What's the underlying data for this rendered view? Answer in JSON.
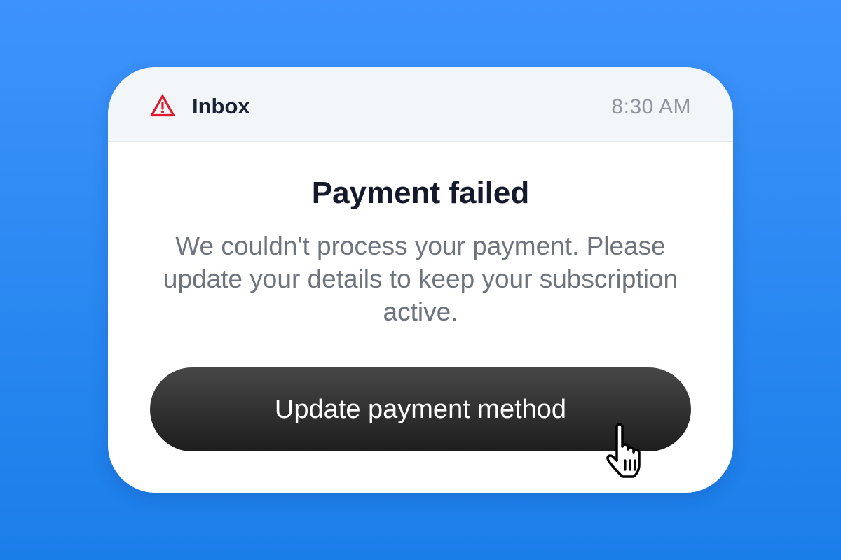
{
  "header": {
    "icon": "alert-triangle-icon",
    "title": "Inbox",
    "time": "8:30 AM"
  },
  "notification": {
    "title": "Payment failed",
    "message": "We couldn't process your payment. Please update your details to keep your subscription active.",
    "action_label": "Update payment method"
  },
  "colors": {
    "alert": "#e0192e",
    "background": "#2a88f3",
    "button": "#2d2d2d"
  },
  "cursor": "hand-pointer-icon"
}
